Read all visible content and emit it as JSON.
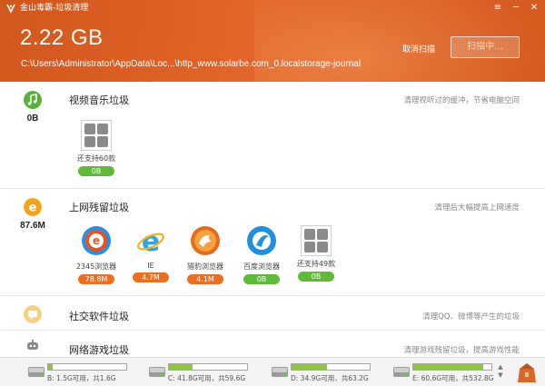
{
  "window": {
    "title": "金山毒霸-垃圾清理",
    "menu_glyph": "≡",
    "minimize_glyph": "─",
    "close_glyph": "✕"
  },
  "header": {
    "total_size": "2.22 GB",
    "scan_path": "C:\\Users\\Administrator\\AppData\\Loc...\\http_www.solarbe.com_0.localstorage-journal",
    "cancel_label": "取消扫描",
    "scan_button_label": "扫描中..."
  },
  "sections": [
    {
      "title": "视频音乐垃圾",
      "hint": "清理视听过的缓冲，节省电脑空间",
      "size": "0B",
      "icon": "music-note-icon",
      "color": "#55b13a",
      "items": [
        {
          "label": "还支持60款",
          "badge": "0B",
          "badge_color": "green",
          "icon": "grid-more-icon"
        }
      ]
    },
    {
      "title": "上网残留垃圾",
      "hint": "清理后大幅提高上网速度",
      "size": "87.6M",
      "icon": "ie-e-icon",
      "color": "#f4a21a",
      "items": [
        {
          "label": "2345浏览器",
          "badge": "78.8M",
          "badge_color": "orange",
          "icon": "browser-2345-icon"
        },
        {
          "label": "IE",
          "badge": "4.7M",
          "badge_color": "orange",
          "icon": "ie-browser-icon"
        },
        {
          "label": "猎豹浏览器",
          "badge": "4.1M",
          "badge_color": "orange",
          "icon": "liebao-browser-icon"
        },
        {
          "label": "百度浏览器",
          "badge": "0B",
          "badge_color": "green",
          "icon": "baidu-browser-icon"
        },
        {
          "label": "还支持49款",
          "badge": "0B",
          "badge_color": "green",
          "icon": "grid-more-icon"
        }
      ]
    },
    {
      "title": "社交软件垃圾",
      "hint": "清理QQ、微博等产生的垃圾",
      "icon": "chat-bubble-icon",
      "color": "#f7cf83"
    },
    {
      "title": "网络游戏垃圾",
      "hint": "清理游戏残留垃圾，提高游戏性能",
      "icon": "gamepad-icon",
      "color": "#888888"
    }
  ],
  "drives": [
    {
      "label": "B: 1.5G可用，共1.6G",
      "used_fraction": 0.06
    },
    {
      "label": "C: 41.8G可用，共59.6G",
      "used_fraction": 0.3
    },
    {
      "label": "D: 34.9G可用，共63.2G",
      "used_fraction": 0.45
    },
    {
      "label": "E: 60.6G可用，共532.8G",
      "used_fraction": 0.89
    }
  ],
  "colors": {
    "header_orange": "#dc5f24",
    "badge_green": "#5fba3a",
    "badge_orange": "#ec6e22"
  }
}
